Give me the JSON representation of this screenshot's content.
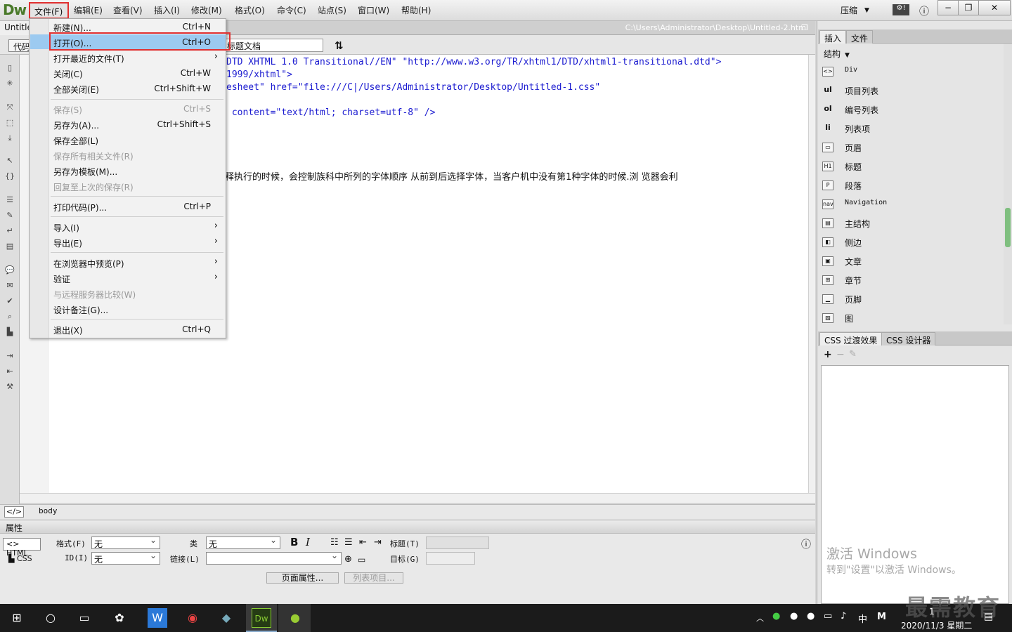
{
  "app": {
    "logo": "Dw",
    "doc_tab": "Untitle",
    "doc_path": "C:\\Users\\Administrator\\Desktop\\Untitled-2.html",
    "compress_label": "压缩"
  },
  "menubar": [
    "文件(F)",
    "编辑(E)",
    "查看(V)",
    "插入(I)",
    "修改(M)",
    "格式(O)",
    "命令(C)",
    "站点(S)",
    "窗口(W)",
    "帮助(H)"
  ],
  "toolbar": {
    "code_btn": "代码",
    "title_value": "标题文档"
  },
  "code": [
    "DTD XHTML 1.0 Transitional//EN\" \"http://www.w3.org/TR/xhtml1/DTD/xhtml1-transitional.dtd\">",
    "1999/xhtml\">",
    "esheet\" href=\"file:///C|/Users/Administrator/Desktop/Untitled-1.css\"",
    " content=\"text/html; charset=utf-8\" />"
  ],
  "code_text": "释执行的时候，会控制族科中所列的字体顺序 从前到后选择字体，当客户机中没有第1种字体的时候.浏 览器会利",
  "file_menu": [
    {
      "label": "新建(N)...",
      "shortcut": "Ctrl+N"
    },
    {
      "label": "打开(O)...",
      "shortcut": "Ctrl+O"
    },
    {
      "label": "打开最近的文件(T)",
      "shortcut": ""
    },
    {
      "label": "关闭(C)",
      "shortcut": "Ctrl+W"
    },
    {
      "label": "全部关闭(E)",
      "shortcut": "Ctrl+Shift+W"
    },
    {
      "label": "保存(S)",
      "shortcut": "Ctrl+S"
    },
    {
      "label": "另存为(A)...",
      "shortcut": "Ctrl+Shift+S"
    },
    {
      "label": "保存全部(L)",
      "shortcut": ""
    },
    {
      "label": "保存所有相关文件(R)",
      "shortcut": ""
    },
    {
      "label": "另存为模板(M)...",
      "shortcut": ""
    },
    {
      "label": "回复至上次的保存(R)",
      "shortcut": ""
    },
    {
      "label": "打印代码(P)...",
      "shortcut": "Ctrl+P"
    },
    {
      "label": "导入(I)",
      "shortcut": ""
    },
    {
      "label": "导出(E)",
      "shortcut": ""
    },
    {
      "label": "在浏览器中预览(P)",
      "shortcut": ""
    },
    {
      "label": "验证",
      "shortcut": ""
    },
    {
      "label": "与远程服务器比较(W)",
      "shortcut": ""
    },
    {
      "label": "设计备注(G)...",
      "shortcut": ""
    },
    {
      "label": "退出(X)",
      "shortcut": "Ctrl+Q"
    }
  ],
  "tagbar": {
    "tag": "body"
  },
  "properties": {
    "title": "属性",
    "html_btn": "HTML",
    "css_btn": "CSS",
    "format_label": "格式(F)",
    "format_value": "无",
    "id_label": "ID(I)",
    "id_value": "无",
    "class_label": "类",
    "class_value": "无",
    "link_label": "链接(L)",
    "link_value": "",
    "title_label": "标题(T)",
    "target_label": "目标(G)",
    "bold": "B",
    "italic": "I",
    "page_props": "页面属性...",
    "list_item": "列表项目..."
  },
  "right_panel": {
    "tabs": [
      "插入",
      "文件"
    ],
    "category": "结构",
    "items": [
      {
        "icon": "<>",
        "label": "Div"
      },
      {
        "icon": "ul",
        "label": "项目列表"
      },
      {
        "icon": "ol",
        "label": "编号列表"
      },
      {
        "icon": "li",
        "label": "列表项"
      },
      {
        "icon": "▭",
        "label": "页眉"
      },
      {
        "icon": "H1",
        "label": "标题"
      },
      {
        "icon": "P",
        "label": "段落"
      },
      {
        "icon": "nav",
        "label": "Navigation"
      },
      {
        "icon": "▤",
        "label": "主结构"
      },
      {
        "icon": "◧",
        "label": "侧边"
      },
      {
        "icon": "▣",
        "label": "文章"
      },
      {
        "icon": "⊞",
        "label": "章节"
      },
      {
        "icon": "▁",
        "label": "页脚"
      },
      {
        "icon": "▨",
        "label": "图"
      }
    ],
    "css_tabs": [
      "CSS 过渡效果",
      "CSS 设计器"
    ],
    "activate_title": "激活 Windows",
    "activate_sub": "转到\"设置\"以激活 Windows。"
  },
  "taskbar": {
    "ime": "中",
    "date": "2020/11/3 星期二",
    "time": "1",
    "watermark": "最需教育"
  }
}
